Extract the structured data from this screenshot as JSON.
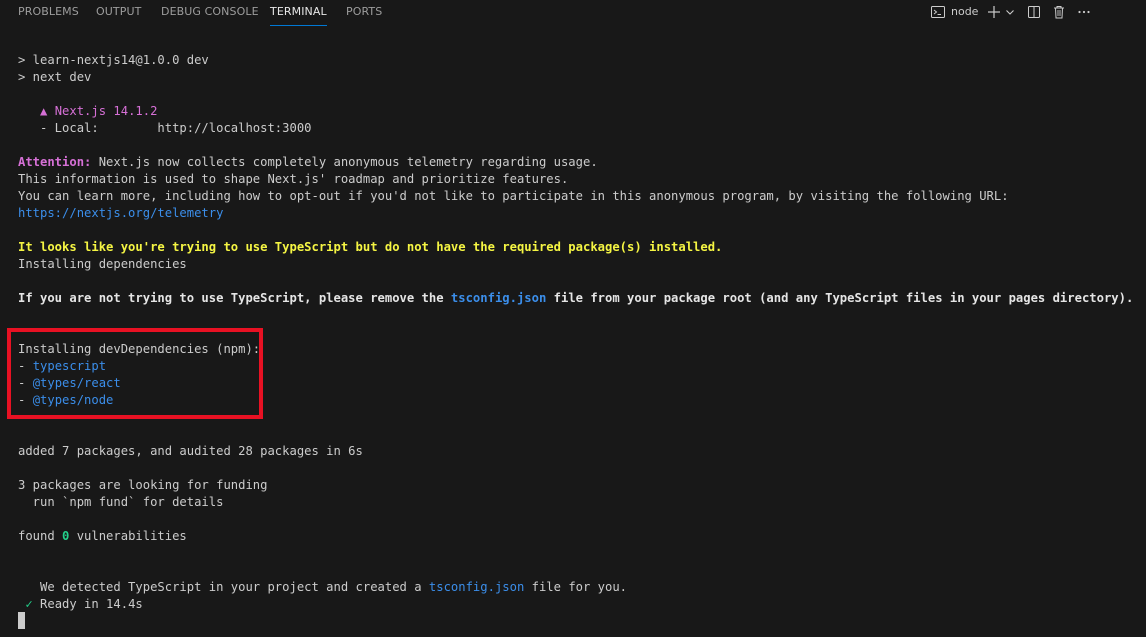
{
  "panel": {
    "tabs": [
      {
        "label": "PROBLEMS"
      },
      {
        "label": "OUTPUT"
      },
      {
        "label": "DEBUG CONSOLE"
      },
      {
        "label": "TERMINAL",
        "active": true
      },
      {
        "label": "PORTS"
      }
    ],
    "toolbar": {
      "terminal_name": "node",
      "icons": [
        "terminal-icon",
        "plus-icon",
        "chevron-down-icon",
        "split-terminal-icon",
        "trash-icon",
        "more-icon"
      ]
    }
  },
  "terminal": {
    "lines": {
      "l1": "> learn-nextjs14@1.0.0 dev",
      "l2": "> next dev",
      "l3_prefix": "   ",
      "l3": "▲ Next.js 14.1.2",
      "l4": "   - Local:        http://localhost:3000",
      "l5_label": "Attention:",
      "l5_rest": " Next.js now collects completely anonymous telemetry regarding usage.",
      "l6": "This information is used to shape Next.js' roadmap and prioritize features.",
      "l7": "You can learn more, including how to opt-out if you'd not like to participate in this anonymous program, by visiting the following URL:",
      "l8": "https://nextjs.org/telemetry",
      "l9": "It looks like you're trying to use TypeScript but do not have the required package(s) installed.",
      "l10": "Installing dependencies",
      "l11_a": "If you are not trying to use TypeScript, please remove the ",
      "l11_b": "tsconfig.json",
      "l11_c": " file from your package root (and any TypeScript files in your pages directory).",
      "l12": "Installing devDependencies (npm):",
      "l13_dash": "- ",
      "l13": "typescript",
      "l14_dash": "- ",
      "l14": "@types/react",
      "l15_dash": "- ",
      "l15": "@types/node",
      "l16": "added 7 packages, and audited 28 packages in 6s",
      "l17": "3 packages are looking for funding",
      "l18": "  run `npm fund` for details",
      "l19_a": "found ",
      "l19_b": "0",
      "l19_c": " vulnerabilities",
      "l20_a": "   We detected TypeScript in your project and created a ",
      "l20_b": "tsconfig.json",
      "l20_c": " file for you.",
      "l21_prefix": " ",
      "l21_check": "✓",
      "l21": " Ready in 14.4s"
    }
  },
  "colors": {
    "background": "#181818",
    "text": "#cccccc",
    "magenta": "#d670d6",
    "link": "#3b8eea",
    "yellow": "#f5f543",
    "green": "#23d18b",
    "highlight_border": "#e81123",
    "active_tab_underline": "#0078d4"
  }
}
